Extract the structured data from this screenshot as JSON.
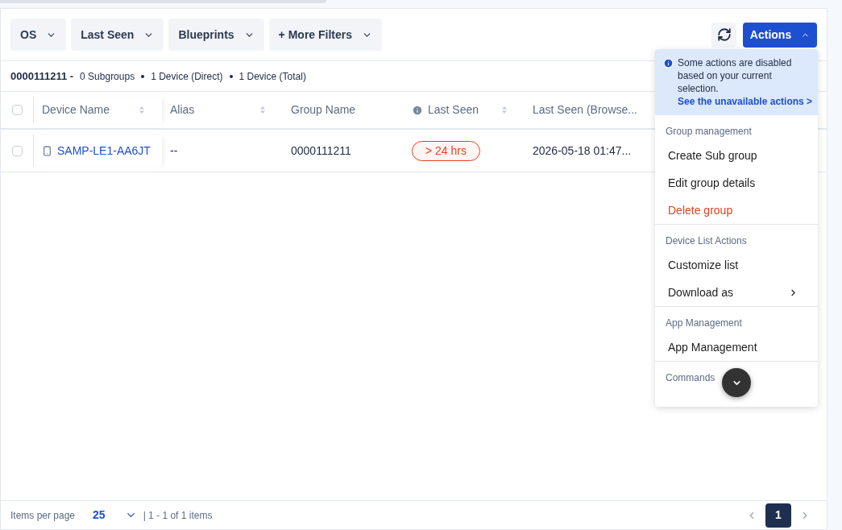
{
  "filters": [
    {
      "label": "OS"
    },
    {
      "label": "Last Seen"
    },
    {
      "label": "Blueprints"
    },
    {
      "label": "+ More Filters"
    }
  ],
  "actions_button": {
    "label": "Actions",
    "expanded": true
  },
  "summary": {
    "group": "0000111211 -",
    "stats": [
      "0 Subgroups",
      "1 Device (Direct)",
      "1 Device (Total)"
    ]
  },
  "table": {
    "all_checked": false,
    "columns": [
      {
        "label": "Device Name",
        "sortable": true,
        "info": false
      },
      {
        "label": "Alias",
        "sortable": true,
        "info": false
      },
      {
        "label": "Group Name",
        "sortable": false,
        "info": false
      },
      {
        "label": "Last Seen",
        "sortable": true,
        "info": true
      },
      {
        "label": "Last Seen (Browse...",
        "sortable": false,
        "info": false
      }
    ],
    "rows": [
      {
        "checked": false,
        "device": "SAMP-LE1-AA6JT",
        "alias": "--",
        "group": "0000111211",
        "last_seen": "> 24 hrs",
        "last_seen_browser": "2026-05-18 01:47..."
      }
    ]
  },
  "menu": {
    "notice": "Some actions are disabled based on your current selection.",
    "notice_link": "See the unavailable actions >",
    "sections": [
      {
        "title": "Group management",
        "items": [
          {
            "label": "Create Sub group",
            "kind": "plain"
          },
          {
            "label": "Edit group details",
            "kind": "plain"
          },
          {
            "label": "Delete group",
            "kind": "danger"
          }
        ]
      },
      {
        "title": "Device List Actions",
        "items": [
          {
            "label": "Customize list",
            "kind": "plain"
          },
          {
            "label": "Download as",
            "kind": "submenu"
          }
        ]
      },
      {
        "title": "App Management",
        "items": [
          {
            "label": "App Management",
            "kind": "plain"
          }
        ]
      },
      {
        "title": "Commands"
      }
    ]
  },
  "footer": {
    "label": "Items per page",
    "per_page": "25",
    "range": "| 1 - 1 of 1 items",
    "pages": [
      {
        "label": "1",
        "selected": true
      }
    ]
  }
}
